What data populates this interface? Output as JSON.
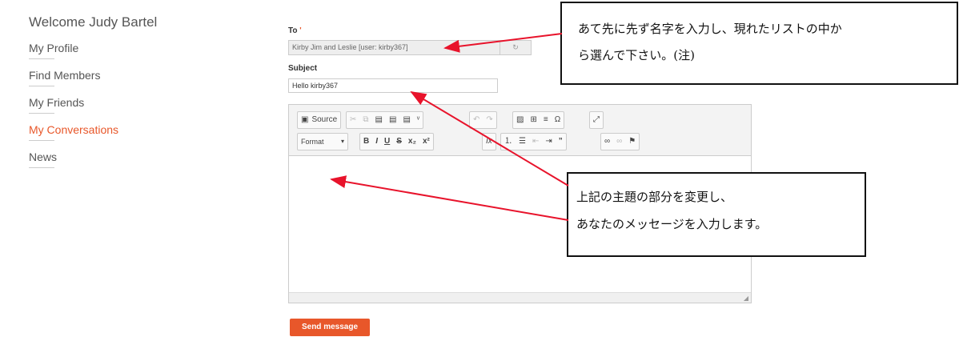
{
  "sidebar": {
    "welcome": "Welcome Judy Bartel",
    "items": [
      {
        "label": "My Profile",
        "active": false
      },
      {
        "label": "Find Members",
        "active": false
      },
      {
        "label": "My Friends",
        "active": false
      },
      {
        "label": "My Conversations",
        "active": true
      },
      {
        "label": "News",
        "active": false
      }
    ]
  },
  "form": {
    "to_label": "To",
    "to_value": "Kirby Jim and Leslie [user: kirby367]",
    "subject_label": "Subject",
    "subject_value": "Hello kirby367",
    "send_label": "Send message"
  },
  "editor": {
    "source_label": "Source",
    "format_label": "Format"
  },
  "annotations": {
    "note1_line1": "あて先に先ず名字を入力し、現れたリストの中か",
    "note1_line2": "ら選んで下さい。(注)",
    "note2_line1": "上記の主題の部分を変更し、",
    "note2_line2": "あなたのメッセージを入力します。"
  },
  "colors": {
    "accent": "#e8572a",
    "arrow": "#e8132b"
  }
}
